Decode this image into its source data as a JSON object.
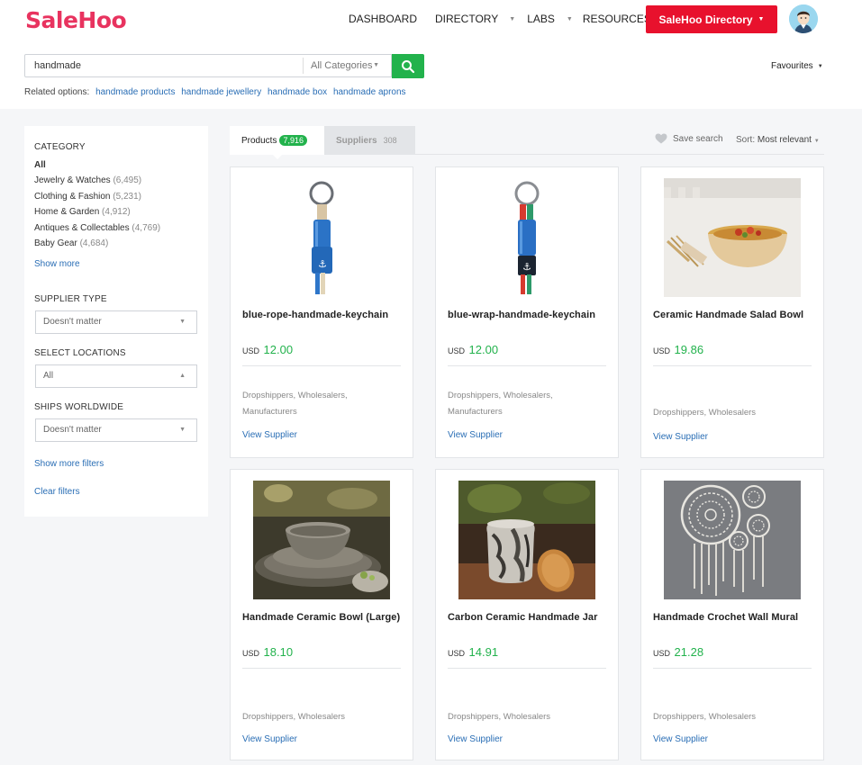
{
  "brand": {
    "logo_text": "SaleHoo",
    "accent": "#e8335f",
    "primary_red": "#e8112d",
    "green": "#22b24c",
    "link_blue": "#2a6eb5"
  },
  "nav": {
    "dashboard": "DASHBOARD",
    "directory": "DIRECTORY",
    "labs": "LABS",
    "resources": "RESOURCES",
    "directory_button": "SaleHoo Directory"
  },
  "search": {
    "value": "handmade",
    "category": "All Categories",
    "icon": "search-icon"
  },
  "favourites": "Favourites",
  "related": {
    "label": "Related options:",
    "items": [
      "handmade products",
      "handmade jewellery",
      "handmade box",
      "handmade aprons"
    ]
  },
  "sidebar": {
    "category_heading": "CATEGORY",
    "categories": [
      {
        "label": "All",
        "count": ""
      },
      {
        "label": "Jewelry & Watches",
        "count": "(6,495)"
      },
      {
        "label": "Clothing & Fashion",
        "count": "(5,231)"
      },
      {
        "label": "Home & Garden",
        "count": "(4,912)"
      },
      {
        "label": "Antiques & Collectables",
        "count": "(4,769)"
      },
      {
        "label": "Baby Gear",
        "count": "(4,684)"
      }
    ],
    "show_more": "Show more",
    "supplier_type_heading": "SUPPLIER TYPE",
    "supplier_type_value": "Doesn't matter",
    "locations_heading": "SELECT LOCATIONS",
    "locations_value": "All",
    "ships_heading": "SHIPS WORLDWIDE",
    "ships_value": "Doesn't matter",
    "show_more_filters": "Show more filters",
    "clear_filters": "Clear filters"
  },
  "tabs": {
    "products_label": "Products",
    "products_count": "7,916",
    "suppliers_label": "Suppliers",
    "suppliers_count": "308"
  },
  "toolbar": {
    "save_search": "Save search",
    "sort_label": "Sort:",
    "sort_value": "Most relevant"
  },
  "products": [
    {
      "title": "blue-rope-handmade-keychain",
      "currency": "USD",
      "price": "12.00",
      "supplier_types": [
        "Dropshippers, Wholesalers,",
        "Manufacturers"
      ],
      "link": "View Supplier"
    },
    {
      "title": "blue-wrap-handmade-keychain",
      "currency": "USD",
      "price": "12.00",
      "supplier_types": [
        "Dropshippers, Wholesalers,",
        "Manufacturers"
      ],
      "link": "View Supplier"
    },
    {
      "title": "Ceramic Handmade Salad Bowl",
      "currency": "USD",
      "price": "19.86",
      "supplier_types": [
        "Dropshippers, Wholesalers"
      ],
      "link": "View Supplier"
    },
    {
      "title": "Handmade Ceramic Bowl (Large)",
      "currency": "USD",
      "price": "18.10",
      "supplier_types": [
        "Dropshippers, Wholesalers"
      ],
      "link": "View Supplier"
    },
    {
      "title": "Carbon Ceramic Handmade Jar",
      "currency": "USD",
      "price": "14.91",
      "supplier_types": [
        "Dropshippers, Wholesalers"
      ],
      "link": "View Supplier"
    },
    {
      "title": "Handmade Crochet Wall Mural",
      "currency": "USD",
      "price": "21.28",
      "supplier_types": [
        "Dropshippers, Wholesalers"
      ],
      "link": "View Supplier"
    }
  ]
}
